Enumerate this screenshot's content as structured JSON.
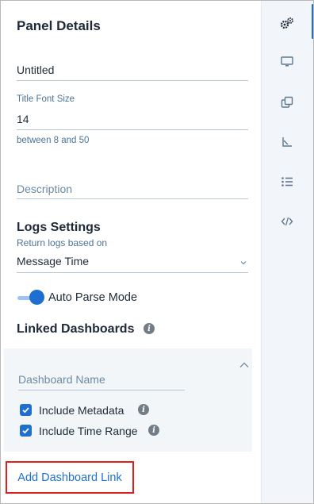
{
  "panel": {
    "title": "Panel Details",
    "title_value": "Untitled",
    "font_size_label": "Title Font Size",
    "font_size_value": "14",
    "font_size_hint": "between 8 and 50",
    "description_placeholder": "Description"
  },
  "logs": {
    "heading": "Logs Settings",
    "return_label": "Return logs based on",
    "selected": "Message Time",
    "auto_parse_label": "Auto Parse Mode",
    "auto_parse_on": true
  },
  "linked": {
    "heading": "Linked Dashboards",
    "dashboard_name_placeholder": "Dashboard Name",
    "include_metadata_label": "Include Metadata",
    "include_time_range_label": "Include Time Range",
    "add_button_label": "Add Dashboard Link"
  },
  "rail": {
    "icons": [
      "gears-icon",
      "monitor-icon",
      "copy-icon",
      "axis-icon",
      "list-icon",
      "code-icon"
    ],
    "active_index": 0
  },
  "colors": {
    "accent": "#1f6fd1",
    "highlight_border": "#e02020",
    "rail_bg": "#f2f6fa"
  }
}
